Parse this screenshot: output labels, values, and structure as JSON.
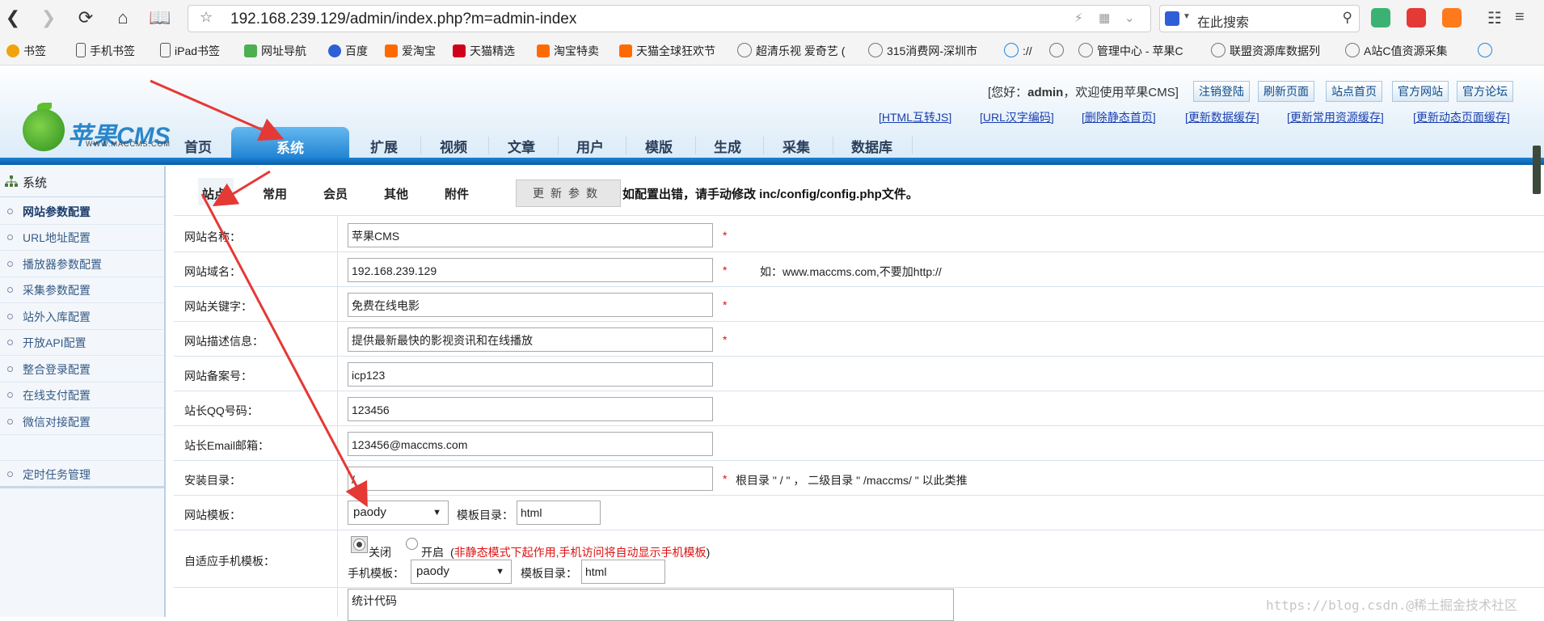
{
  "browser": {
    "url": "192.168.239.129/admin/index.php?m=admin-index",
    "search_placeholder": "在此搜索"
  },
  "bookmarks": [
    {
      "label": "书签",
      "color": "#f0a30a"
    },
    {
      "label": "手机书签",
      "color": "#555555"
    },
    {
      "label": "iPad书签",
      "color": "#555555"
    },
    {
      "label": "网址导航",
      "color": "#4caf50"
    },
    {
      "label": "百度",
      "color": "#2f5fd6"
    },
    {
      "label": "爱淘宝",
      "color": "#ff6a00"
    },
    {
      "label": "天猫精选",
      "color": "#d0021b"
    },
    {
      "label": "淘宝特卖",
      "color": "#ff6a00"
    },
    {
      "label": "天猫全球狂欢节",
      "color": "#ff6a00"
    },
    {
      "label": "超清乐视 爱奇艺 (",
      "color": "#777777"
    },
    {
      "label": "315消费网-深圳市",
      "color": "#777777"
    },
    {
      "label": "://",
      "color": "#1e88e5"
    },
    {
      "label": "",
      "color": "#777777"
    },
    {
      "label": "管理中心 - 苹果C",
      "color": "#777777"
    },
    {
      "label": "联盟资源库数据列",
      "color": "#777777"
    },
    {
      "label": "A站C值资源采集",
      "color": "#777777"
    },
    {
      "label": "",
      "color": "#1e88e5"
    }
  ],
  "header": {
    "logo_text": "苹果CMS",
    "logo_sub": "WWW.MACCMS.COM",
    "welcome_prefix": "[您好：",
    "username": "admin",
    "welcome_suffix": "，欢迎使用苹果CMS]",
    "buttons": [
      "注销登陆",
      "刷新页面",
      "站点首页",
      "官方网站",
      "官方论坛"
    ],
    "links": [
      "[HTML互转JS]",
      "[URL汉字编码]",
      "[删除静态首页]",
      "[更新数据缓存]",
      "[更新常用资源缓存]",
      "[更新动态页面缓存]"
    ]
  },
  "main_nav": [
    "首页",
    "系统",
    "扩展",
    "视频",
    "文章",
    "用户",
    "模版",
    "生成",
    "采集",
    "数据库"
  ],
  "main_nav_active": "系统",
  "sidebar": {
    "title": "系统",
    "items": [
      "网站参数配置",
      "URL地址配置",
      "播放器参数配置",
      "采集参数配置",
      "站外入库配置",
      "开放API配置",
      "整合登录配置",
      "在线支付配置",
      "微信对接配置"
    ],
    "extra_item": "定时任务管理"
  },
  "sub_tabs": [
    "站点",
    "常用",
    "会员",
    "其他",
    "附件"
  ],
  "update_button": "更新参数",
  "config_hint": "如配置出错，请手动修改 inc/config/config.php文件。",
  "form": {
    "site_name": {
      "label": "网站名称：",
      "value": "苹果CMS"
    },
    "site_domain": {
      "label": "网站域名：",
      "value": "192.168.239.129",
      "note": "如：www.maccms.com,不要加http://"
    },
    "site_keywords": {
      "label": "网站关键字：",
      "value": "免费在线电影"
    },
    "site_desc": {
      "label": "网站描述信息：",
      "value": "提供最新最快的影视资讯和在线播放"
    },
    "site_icp": {
      "label": "网站备案号：",
      "value": "icp123"
    },
    "site_qq": {
      "label": "站长QQ号码：",
      "value": "123456"
    },
    "site_email": {
      "label": "站长Email邮箱：",
      "value": "123456@maccms.com"
    },
    "install_dir": {
      "label": "安装目录：",
      "value": "/",
      "note": "根目录 \" / \" ，  二级目录 \" /maccms/ \" 以此类推"
    },
    "template": {
      "label": "网站模板：",
      "value": "paody",
      "dir_label": "模板目录：",
      "dir_value": "html"
    },
    "mobile_template": {
      "label": "自适应手机模板：",
      "off_label": "关闭",
      "on_label": "开启",
      "note_open": "(",
      "note_red": "非静态模式下起作用,手机访问将自动显示手机模板",
      "note_close": ")",
      "mobile_label": "手机模板：",
      "mobile_value": "paody",
      "dir_label": "模板目录：",
      "dir_value": "html"
    },
    "stats_code": {
      "value": "统计代码"
    }
  },
  "watermark": "https://blog.csdn.@稀土掘金技术社区",
  "required_mark": "*"
}
